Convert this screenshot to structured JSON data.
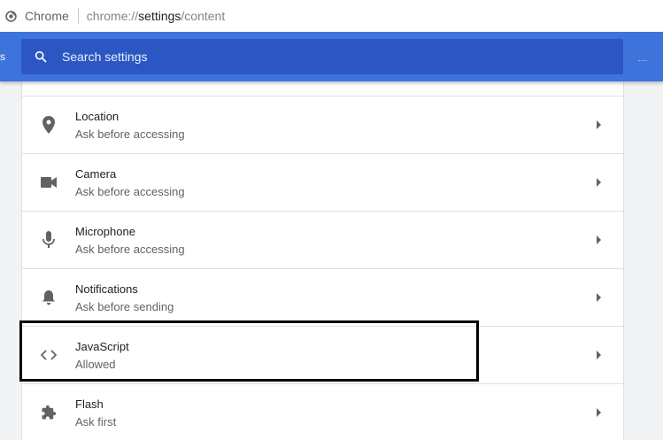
{
  "omnibox": {
    "site_name": "Chrome",
    "url_scheme": "chrome://",
    "url_host": "settings",
    "url_path": "/content"
  },
  "header": {
    "left_edge_glyph": "s",
    "search_placeholder": "Search settings"
  },
  "rows": [
    {
      "title": "Location",
      "subtitle": "Ask before accessing",
      "icon": "location-pin-icon"
    },
    {
      "title": "Camera",
      "subtitle": "Ask before accessing",
      "icon": "camera-icon"
    },
    {
      "title": "Microphone",
      "subtitle": "Ask before accessing",
      "icon": "microphone-icon"
    },
    {
      "title": "Notifications",
      "subtitle": "Ask before sending",
      "icon": "bell-icon"
    },
    {
      "title": "JavaScript",
      "subtitle": "Allowed",
      "icon": "code-brackets-icon"
    },
    {
      "title": "Flash",
      "subtitle": "Ask first",
      "icon": "puzzle-piece-icon"
    }
  ],
  "colors": {
    "header_blue": "#3f73dc",
    "search_blue": "#2c57c3",
    "icon_gray": "#5f6368",
    "divider": "#e0e0e0"
  }
}
